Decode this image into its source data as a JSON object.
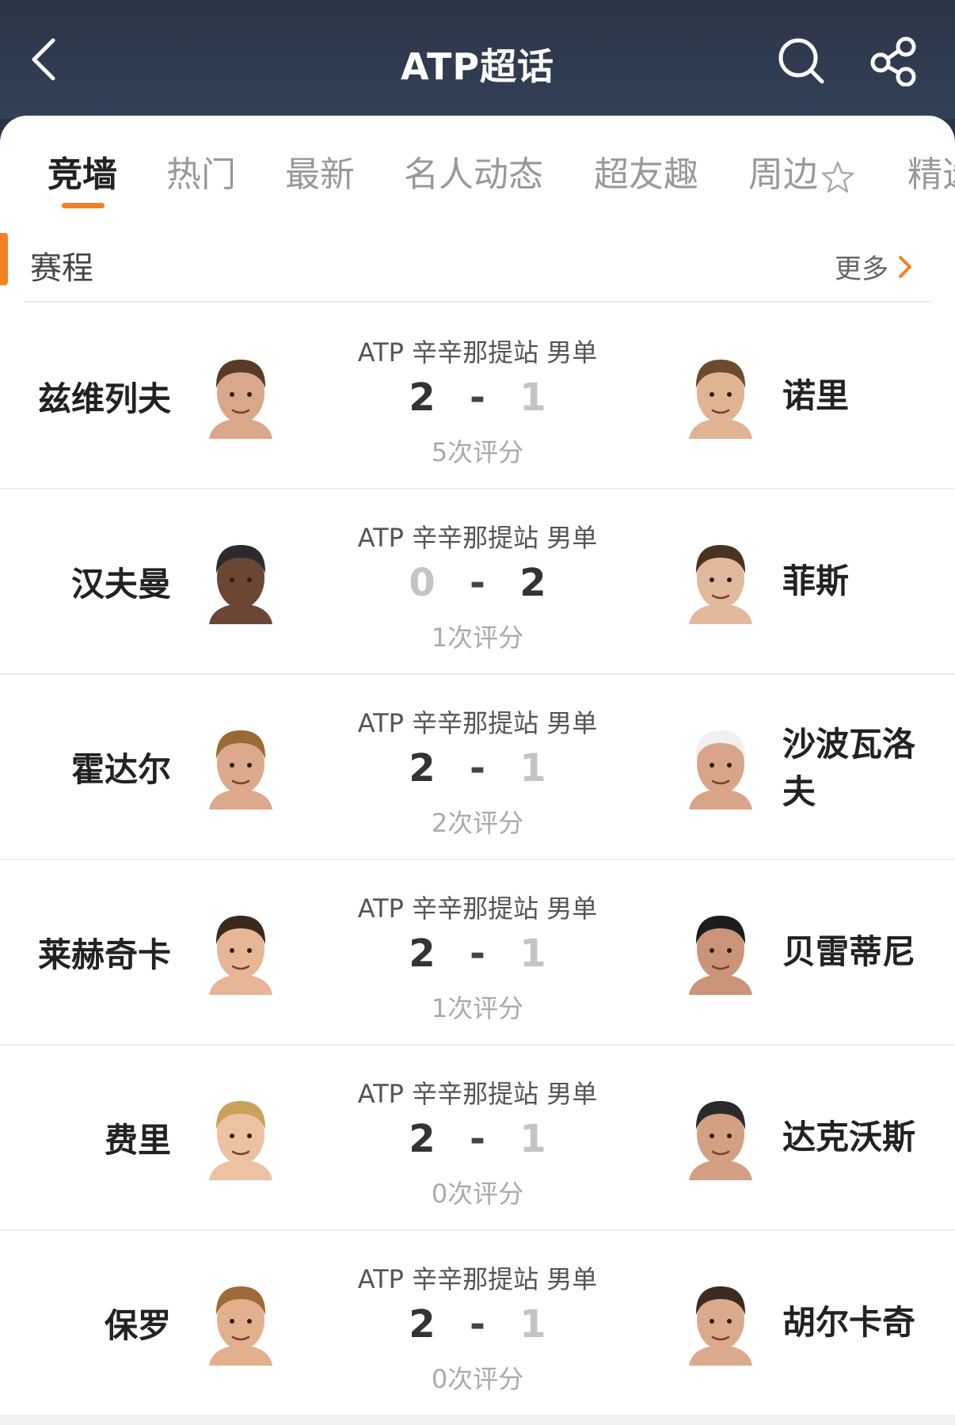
{
  "header": {
    "title": "ATP超话"
  },
  "tabs": [
    {
      "label": "竞墙",
      "active": true
    },
    {
      "label": "热门",
      "active": false
    },
    {
      "label": "最新",
      "active": false
    },
    {
      "label": "名人动态",
      "active": false
    },
    {
      "label": "超友趣",
      "active": false
    },
    {
      "label": "周边",
      "active": false
    },
    {
      "label": "精选",
      "active": false
    }
  ],
  "section": {
    "title": "赛程",
    "more": "更多"
  },
  "matches": [
    {
      "home": "兹维列夫",
      "away": "诺里",
      "event": "ATP 辛辛那提站 男单",
      "home_score": "2",
      "away_score": "1",
      "ratings": "5次评分",
      "winner": "home"
    },
    {
      "home": "汉夫曼",
      "away": "菲斯",
      "event": "ATP 辛辛那提站 男单",
      "home_score": "0",
      "away_score": "2",
      "ratings": "1次评分",
      "winner": "away"
    },
    {
      "home": "霍达尔",
      "away": "沙波瓦洛夫",
      "event": "ATP 辛辛那提站 男单",
      "home_score": "2",
      "away_score": "1",
      "ratings": "2次评分",
      "winner": "home"
    },
    {
      "home": "莱赫奇卡",
      "away": "贝雷蒂尼",
      "event": "ATP 辛辛那提站 男单",
      "home_score": "2",
      "away_score": "1",
      "ratings": "1次评分",
      "winner": "home"
    },
    {
      "home": "费里",
      "away": "达克沃斯",
      "event": "ATP 辛辛那提站 男单",
      "home_score": "2",
      "away_score": "1",
      "ratings": "0次评分",
      "winner": "home"
    },
    {
      "home": "保罗",
      "away": "胡尔卡奇",
      "event": "ATP 辛辛那提站 男单",
      "home_score": "2",
      "away_score": "1",
      "ratings": "0次评分",
      "winner": "home"
    }
  ],
  "score_separator": "-",
  "colors": {
    "header_bg": "#2c3547",
    "accent": "#f58220",
    "loser_score": "#c4c4c4"
  },
  "icons": [
    "back-arrow-icon",
    "search-icon",
    "share-icon",
    "star-icon",
    "chevron-right-icon",
    "player-avatar"
  ]
}
